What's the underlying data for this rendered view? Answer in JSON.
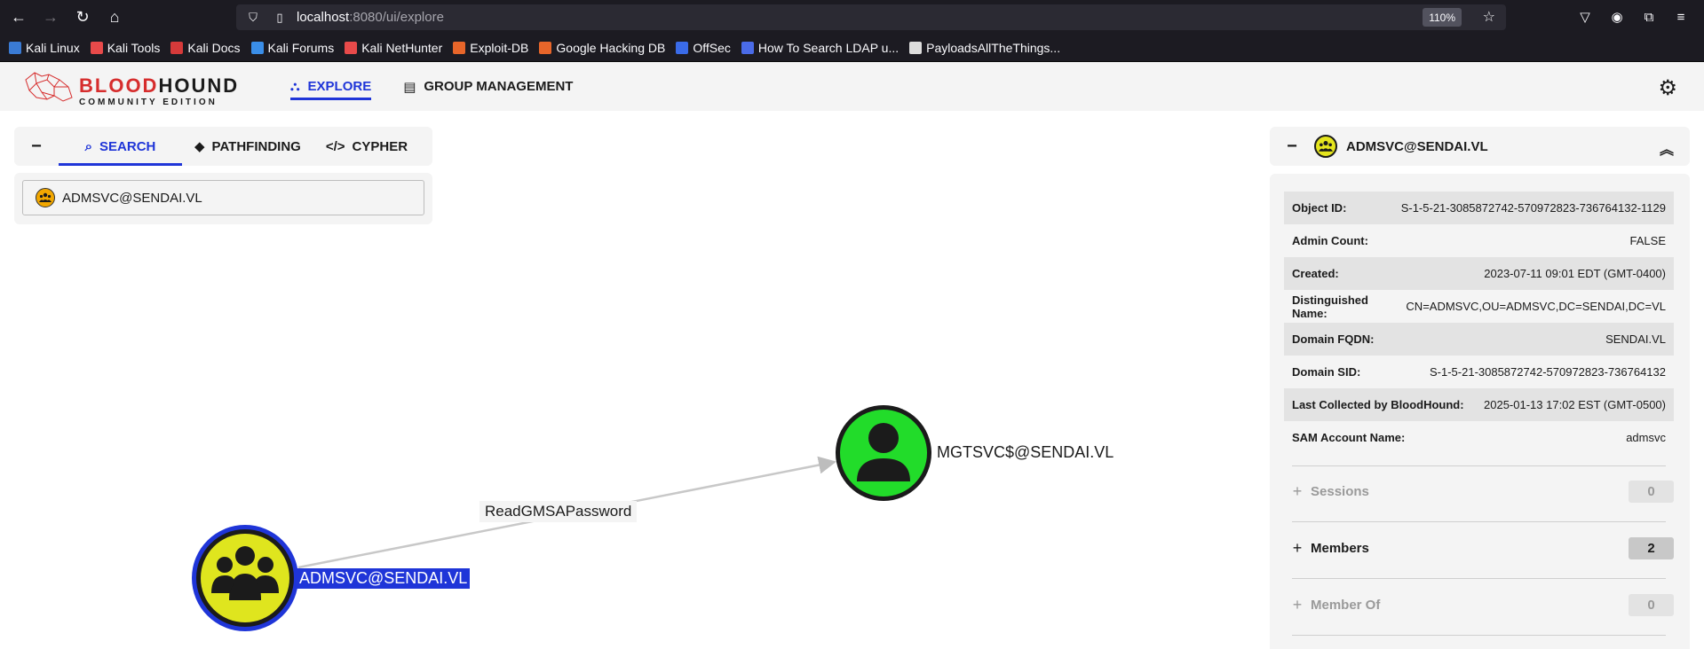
{
  "browser": {
    "url_host": "localhost",
    "url_path": ":8080/ui/explore",
    "zoom": "110%",
    "bookmarks": [
      {
        "label": "Kali Linux",
        "color": "#3a7bd5"
      },
      {
        "label": "Kali Tools",
        "color": "#e84a4a"
      },
      {
        "label": "Kali Docs",
        "color": "#d63a3a"
      },
      {
        "label": "Kali Forums",
        "color": "#3a8ee8"
      },
      {
        "label": "Kali NetHunter",
        "color": "#e84a4a"
      },
      {
        "label": "Exploit-DB",
        "color": "#e8662a"
      },
      {
        "label": "Google Hacking DB",
        "color": "#e8662a"
      },
      {
        "label": "OffSec",
        "color": "#3a6be8"
      },
      {
        "label": "How To Search LDAP u...",
        "color": "#4a6be8"
      },
      {
        "label": "PayloadsAllTheThings...",
        "color": "#dddddd"
      }
    ]
  },
  "app": {
    "logo_main_red": "BLOOD",
    "logo_main_rest": "HOUND",
    "logo_sub": "COMMUNITY EDITION",
    "tabs": [
      {
        "label": "EXPLORE",
        "icon": "graph-icon"
      },
      {
        "label": "GROUP MANAGEMENT",
        "icon": "id-card-icon"
      }
    ]
  },
  "search": {
    "tabs": [
      "SEARCH",
      "PATHFINDING",
      "CYPHER"
    ],
    "query": "ADMSVC@SENDAI.VL"
  },
  "graph": {
    "source_label": "ADMSVC@SENDAI.VL",
    "target_label": "MGTSVC$@SENDAI.VL",
    "edge_label": "ReadGMSAPassword",
    "source_color": "#dfe51e",
    "target_color": "#22dc2a",
    "selected_color": "#1f35d8"
  },
  "entity": {
    "title": "ADMSVC@SENDAI.VL",
    "properties": [
      {
        "key": "Object ID:",
        "value": "S-1-5-21-3085872742-570972823-736764132-1129"
      },
      {
        "key": "Admin Count:",
        "value": "FALSE"
      },
      {
        "key": "Created:",
        "value": "2023-07-11 09:01 EDT (GMT-0400)"
      },
      {
        "key": "Distinguished Name:",
        "value": "CN=ADMSVC,OU=ADMSVC,DC=SENDAI,DC=VL"
      },
      {
        "key": "Domain FQDN:",
        "value": "SENDAI.VL"
      },
      {
        "key": "Domain SID:",
        "value": "S-1-5-21-3085872742-570972823-736764132"
      },
      {
        "key": "Last Collected by BloodHound:",
        "value": "2025-01-13 17:02 EST (GMT-0500)"
      },
      {
        "key": "SAM Account Name:",
        "value": "admsvc"
      }
    ],
    "sections": [
      {
        "label": "Sessions",
        "count": "0"
      },
      {
        "label": "Members",
        "count": "2"
      },
      {
        "label": "Member Of",
        "count": "0"
      }
    ]
  }
}
